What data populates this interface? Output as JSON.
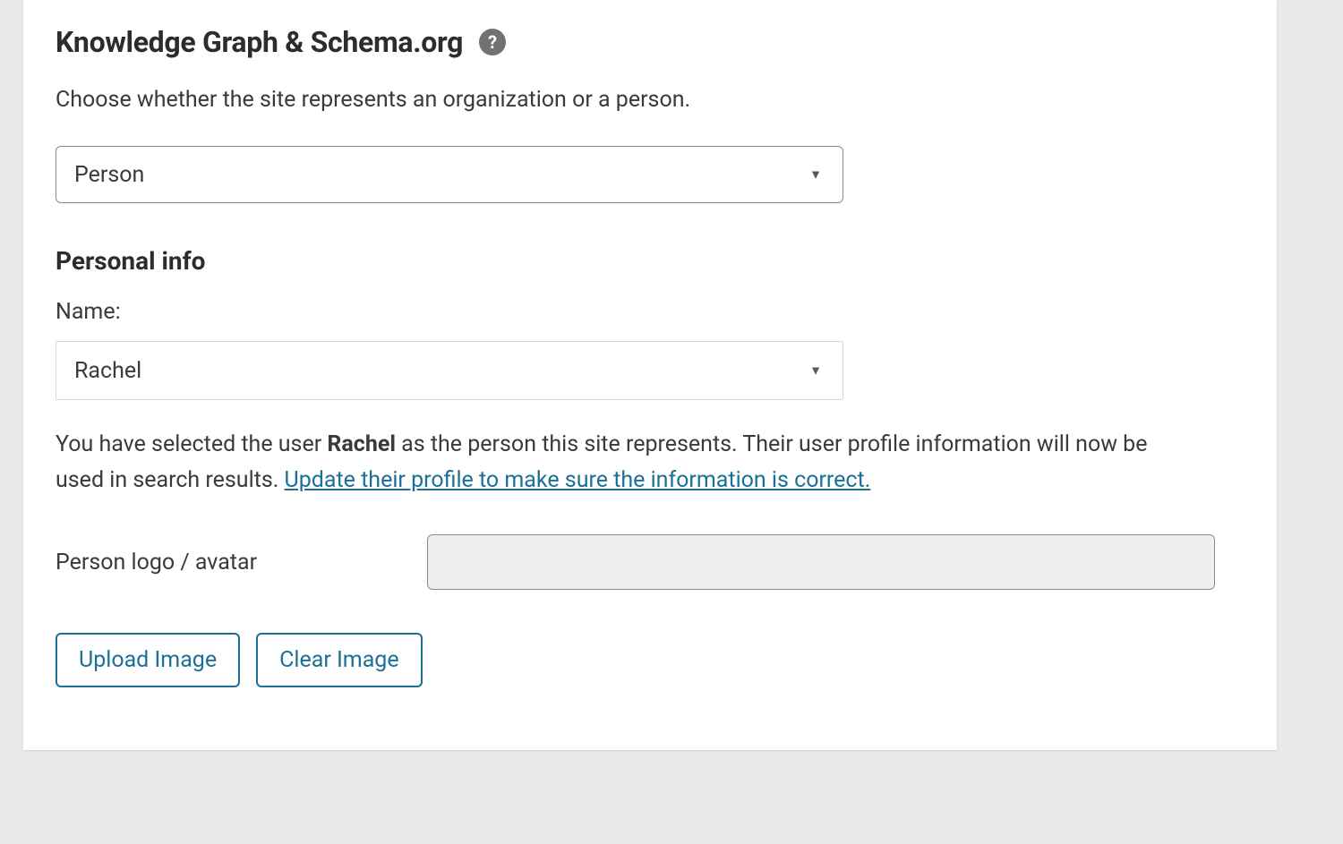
{
  "section": {
    "title": "Knowledge Graph & Schema.org",
    "help_tooltip": "?",
    "description": "Choose whether the site represents an organization or a person.",
    "entity_type_value": "Person"
  },
  "personal": {
    "title": "Personal info",
    "name_label": "Name:",
    "name_value": "Rachel",
    "info_prefix": "You have selected the user ",
    "info_user": "Rachel",
    "info_mid": " as the person this site represents. Their user profile information will now be used in search results. ",
    "info_link": "Update their profile to make sure the information is correct.",
    "logo_label": "Person logo / avatar",
    "logo_value": "",
    "upload_btn": "Upload Image",
    "clear_btn": "Clear Image"
  }
}
